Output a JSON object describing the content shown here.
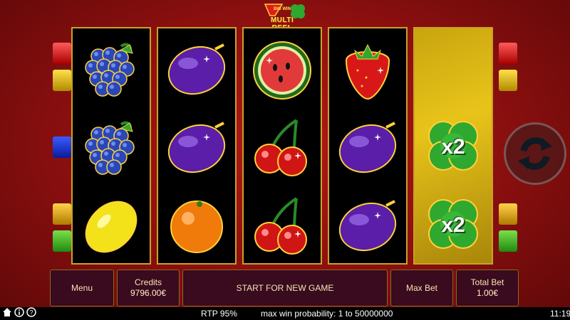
{
  "logo": {
    "line1": "BIG WIN",
    "line2": "MULTI REEL"
  },
  "reels": [
    [
      "grapes",
      "grapes",
      "lemon"
    ],
    [
      "plum",
      "plum",
      "orange"
    ],
    [
      "watermelon",
      "cherries",
      "cherries"
    ],
    [
      "strawberry",
      "plum",
      "plum"
    ],
    [
      "empty",
      "clover-x2",
      "clover-x2"
    ]
  ],
  "multiplier_label": "x2",
  "buttons": {
    "menu": "Menu",
    "credits_label": "Credits",
    "credits_value": "9796.00€",
    "start": "START FOR NEW GAME",
    "max_bet": "Max Bet",
    "total_bet_label": "Total Bet",
    "total_bet_value": "1.00€"
  },
  "status": {
    "rtp": "RTP 95%",
    "max_win": "max win probability: 1 to 50000000",
    "time": "11:19"
  },
  "icons": [
    "home-icon",
    "info-icon",
    "help-icon",
    "spin-icon"
  ],
  "colors": {
    "background": "#8a0f0f",
    "gold": "#c9a227",
    "panel": "#3a0a1e"
  }
}
